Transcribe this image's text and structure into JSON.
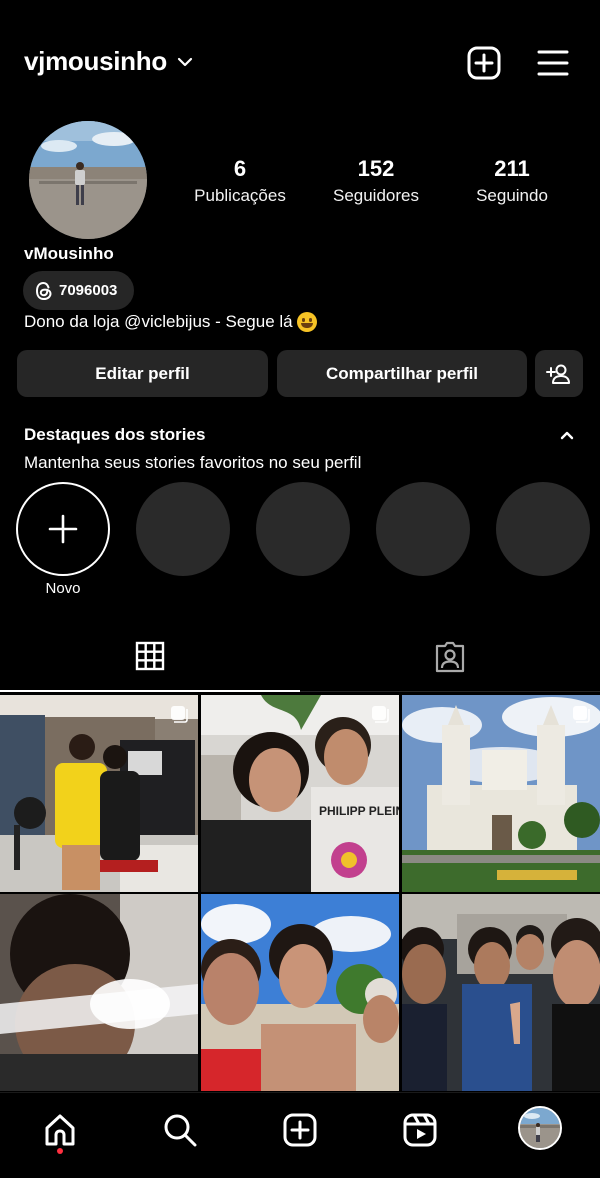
{
  "header": {
    "username": "vjmousinho",
    "icons": [
      "chevron-down-icon",
      "new-post-icon",
      "menu-icon"
    ]
  },
  "profile": {
    "display_name": "vMousinho",
    "threads_badge": "7096003",
    "bio": "Dono da loja @viclebijus - Segue lá",
    "bio_emoji": "grinning-face"
  },
  "stats": {
    "posts": {
      "value": "6",
      "label": "Publicações"
    },
    "followers": {
      "value": "152",
      "label": "Seguidores"
    },
    "following": {
      "value": "211",
      "label": "Seguindo"
    }
  },
  "actions": {
    "edit": "Editar perfil",
    "share": "Compartilhar perfil",
    "discover_icon": "add-person-icon"
  },
  "highlights": {
    "title": "Destaques dos stories",
    "subtitle": "Mantenha seus stories favoritos no seu perfil",
    "new_label": "Novo",
    "placeholder_count": 4
  },
  "tabs": [
    "grid-icon",
    "tagged-icon"
  ],
  "posts": [
    {
      "scene": "two people in a bedroom, yellow Brazil shirt",
      "multi": true
    },
    {
      "scene": "selfie of two people indoors",
      "multi": true
    },
    {
      "scene": "white cathedral with blue sky",
      "multi": true
    },
    {
      "scene": "blurry close-up with light flare",
      "multi": false
    },
    {
      "scene": "three people outdoors with blue sky",
      "multi": false
    },
    {
      "scene": "selfie of four people in a car",
      "multi": false
    }
  ],
  "bottom_nav": [
    "home-icon",
    "search-icon",
    "create-icon",
    "reels-icon",
    "profile-avatar"
  ],
  "colors": {
    "background": "#000000",
    "button": "#262626",
    "notification": "#ff3040"
  }
}
